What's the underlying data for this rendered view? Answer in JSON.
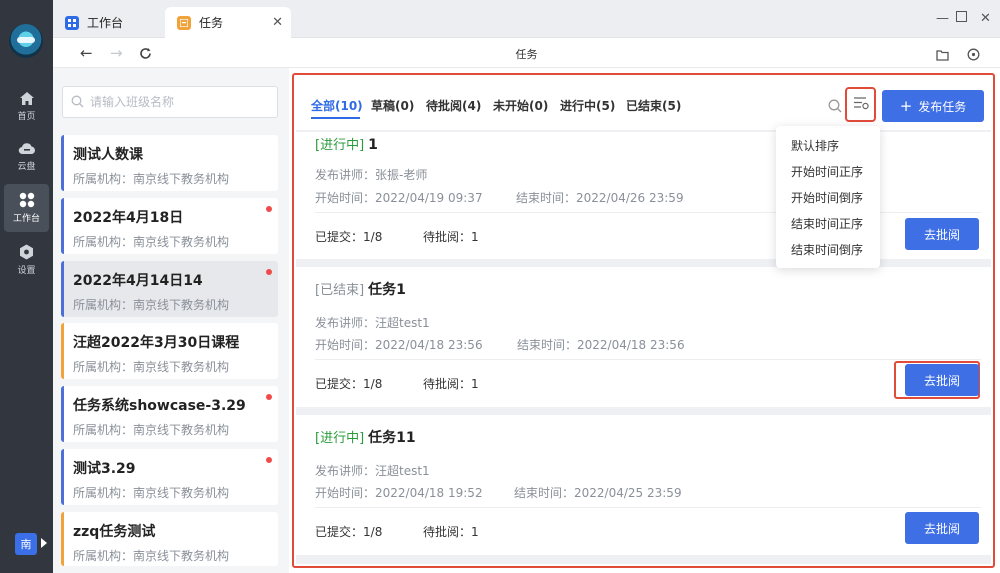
{
  "nav": {
    "items": [
      {
        "label": "首页",
        "icon": "home-icon"
      },
      {
        "label": "云盘",
        "icon": "cloud-icon"
      },
      {
        "label": "工作台",
        "icon": "workspace-icon"
      },
      {
        "label": "设置",
        "icon": "settings-icon"
      }
    ],
    "user_initial": "南"
  },
  "tabs": [
    {
      "label": "工作台",
      "icon": "workspace-tab-icon",
      "color": "#2f6be6"
    },
    {
      "label": "任务",
      "icon": "task-tab-icon",
      "color": "#f0a33a"
    }
  ],
  "toolbar": {
    "title": "任务"
  },
  "sidebar": {
    "search_placeholder": "请输入班级名称",
    "items": [
      {
        "title": "测试人数课",
        "org": "所属机构：南京线下教务机构"
      },
      {
        "title": "2022年4月18日",
        "org": "所属机构：南京线下教务机构"
      },
      {
        "title": "2022年4月14日14",
        "org": "所属机构：南京线下教务机构"
      },
      {
        "title": "汪超2022年3月30日课程",
        "org": "所属机构：南京线下教务机构"
      },
      {
        "title": "任务系统showcase-3.29",
        "org": "所属机构：南京线下教务机构"
      },
      {
        "title": "测试3.29",
        "org": "所属机构：南京线下教务机构"
      },
      {
        "title": "zzq任务测试",
        "org": "所属机构：南京线下教务机构"
      }
    ]
  },
  "filters": [
    "全部(10)",
    "草稿(0)",
    "待批阅(4)",
    "未开始(0)",
    "进行中(5)",
    "已结束(5)"
  ],
  "publish_label": "发布任务",
  "sort_menu": [
    "默认排序",
    "开始时间正序",
    "开始时间倒序",
    "结束时间正序",
    "结束时间倒序"
  ],
  "tasks": [
    {
      "status": "[进行中]",
      "name": "1",
      "teacher_label": "发布讲师：",
      "teacher": "张振-老师",
      "start_label": "开始时间：",
      "start": "2022/04/19 09:37",
      "end_label": "结束时间：",
      "end": "2022/04/26 23:59",
      "submitted_label": "已提交：",
      "submitted": "1/8",
      "pending_label": "待批阅：",
      "pending": "1",
      "review_label": "去批阅"
    },
    {
      "status": "[已结束]",
      "name": "任务1",
      "teacher_label": "发布讲师：",
      "teacher": "汪超test1",
      "start_label": "开始时间：",
      "start": "2022/04/18 23:56",
      "end_label": "结束时间：",
      "end": "2022/04/18 23:56",
      "submitted_label": "已提交：",
      "submitted": "1/8",
      "pending_label": "待批阅：",
      "pending": "1",
      "review_label": "去批阅"
    },
    {
      "status": "[进行中]",
      "name": "任务11",
      "teacher_label": "发布讲师：",
      "teacher": "汪超test1",
      "start_label": "开始时间：",
      "start": "2022/04/18 19:52",
      "end_label": "结束时间：",
      "end": "2022/04/25 23:59",
      "submitted_label": "已提交：",
      "submitted": "1/8",
      "pending_label": "待批阅：",
      "pending": "1",
      "review_label": "去批阅"
    }
  ],
  "colors": {
    "accent": "#3f6fe5",
    "highlight": "#e14b3a",
    "running": "#2b9b3c"
  }
}
